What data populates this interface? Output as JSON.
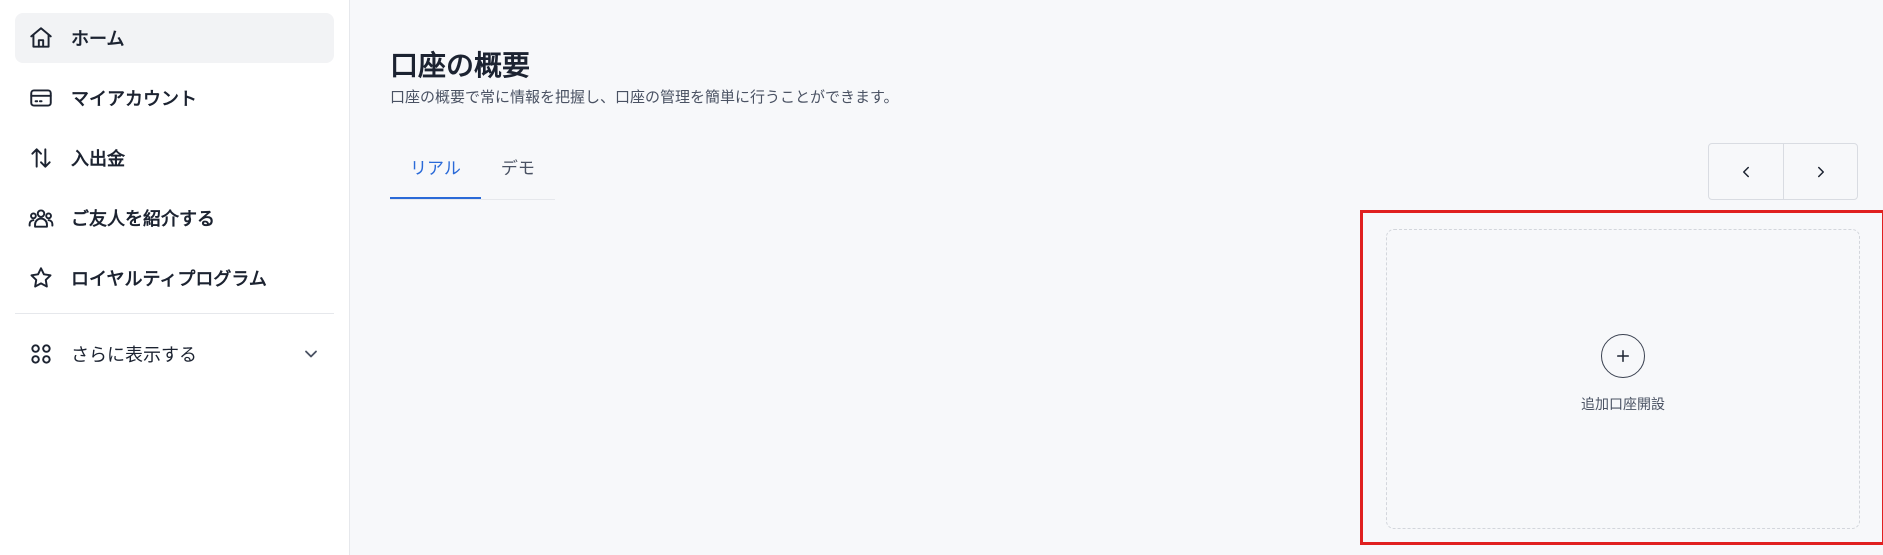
{
  "sidebar": {
    "items": [
      {
        "label": "ホーム",
        "icon": "home-icon"
      },
      {
        "label": "マイアカウント",
        "icon": "card-icon"
      },
      {
        "label": "入出金",
        "icon": "transfer-arrows-icon"
      },
      {
        "label": "ご友人を紹介する",
        "icon": "users-icon"
      },
      {
        "label": "ロイヤルティプログラム",
        "icon": "star-icon"
      }
    ],
    "more": {
      "label": "さらに表示する",
      "icon": "grid-icon"
    }
  },
  "main": {
    "title": "口座の概要",
    "subtitle": "口座の概要で常に情報を把握し、口座の管理を簡単に行うことができます。",
    "tabs": [
      {
        "label": "リアル"
      },
      {
        "label": "デモ"
      }
    ],
    "add_account": {
      "label": "追加口座開設",
      "icon": "plus-icon"
    }
  },
  "colors": {
    "accent": "#2a6ad8",
    "highlight": "#e02020"
  }
}
